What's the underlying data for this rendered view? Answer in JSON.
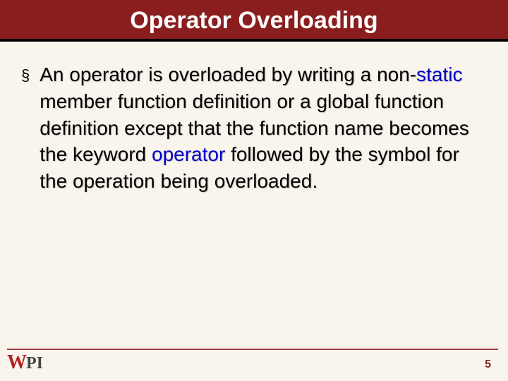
{
  "title": "Operator Overloading",
  "bullet_glyph": "§",
  "body": {
    "t1": "An operator is overloaded by writing a non-",
    "kw_static": "static",
    "t2": " member function definition or a global function definition except that the function name becomes the keyword ",
    "kw_operator": "operator",
    "t3": " followed by the symbol for the operation being overloaded."
  },
  "logo": {
    "w": "W",
    "pi": "PI"
  },
  "page_number": "5"
}
